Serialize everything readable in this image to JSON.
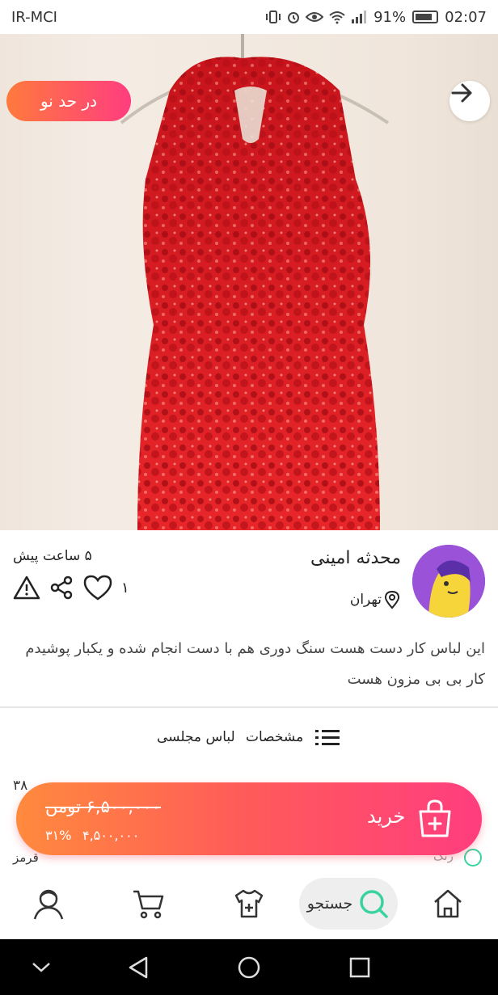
{
  "status_bar": {
    "carrier": "IR-MCI",
    "battery": "91%",
    "time": "02:07"
  },
  "hero": {
    "badge": "در حد نو",
    "back_icon": "arrow-right-icon",
    "dots_count": 3,
    "active_dot": 0
  },
  "seller": {
    "name": "محدثه امینی",
    "city": "تهران",
    "posted": "۵ ساعت پیش",
    "like_count": "۱"
  },
  "description": "این لباس کار دست هست سنگ دوری هم با دست انجام شده و یکبار پوشیدم کار بی بی مزون هست",
  "specs": {
    "label": "مشخصات",
    "value": "لباس مجلسی"
  },
  "hidden_rows": {
    "size_fragment": "۳۸",
    "color_label": "رنگ",
    "color_value": "قرمز"
  },
  "buy_bar": {
    "old_price": "۶,۵۰۰,۰۰۰ تومن",
    "new_price": "۴,۵۰۰,۰۰۰",
    "discount": "۳۱%",
    "buy_label": "خرید"
  },
  "tab_bar": {
    "search_label": "جستجو"
  },
  "colors": {
    "accent_start": "#ff8a3d",
    "accent_end": "#ff3d7f",
    "search_green": "#3ad29f",
    "dress_red": "#d81e1e"
  }
}
